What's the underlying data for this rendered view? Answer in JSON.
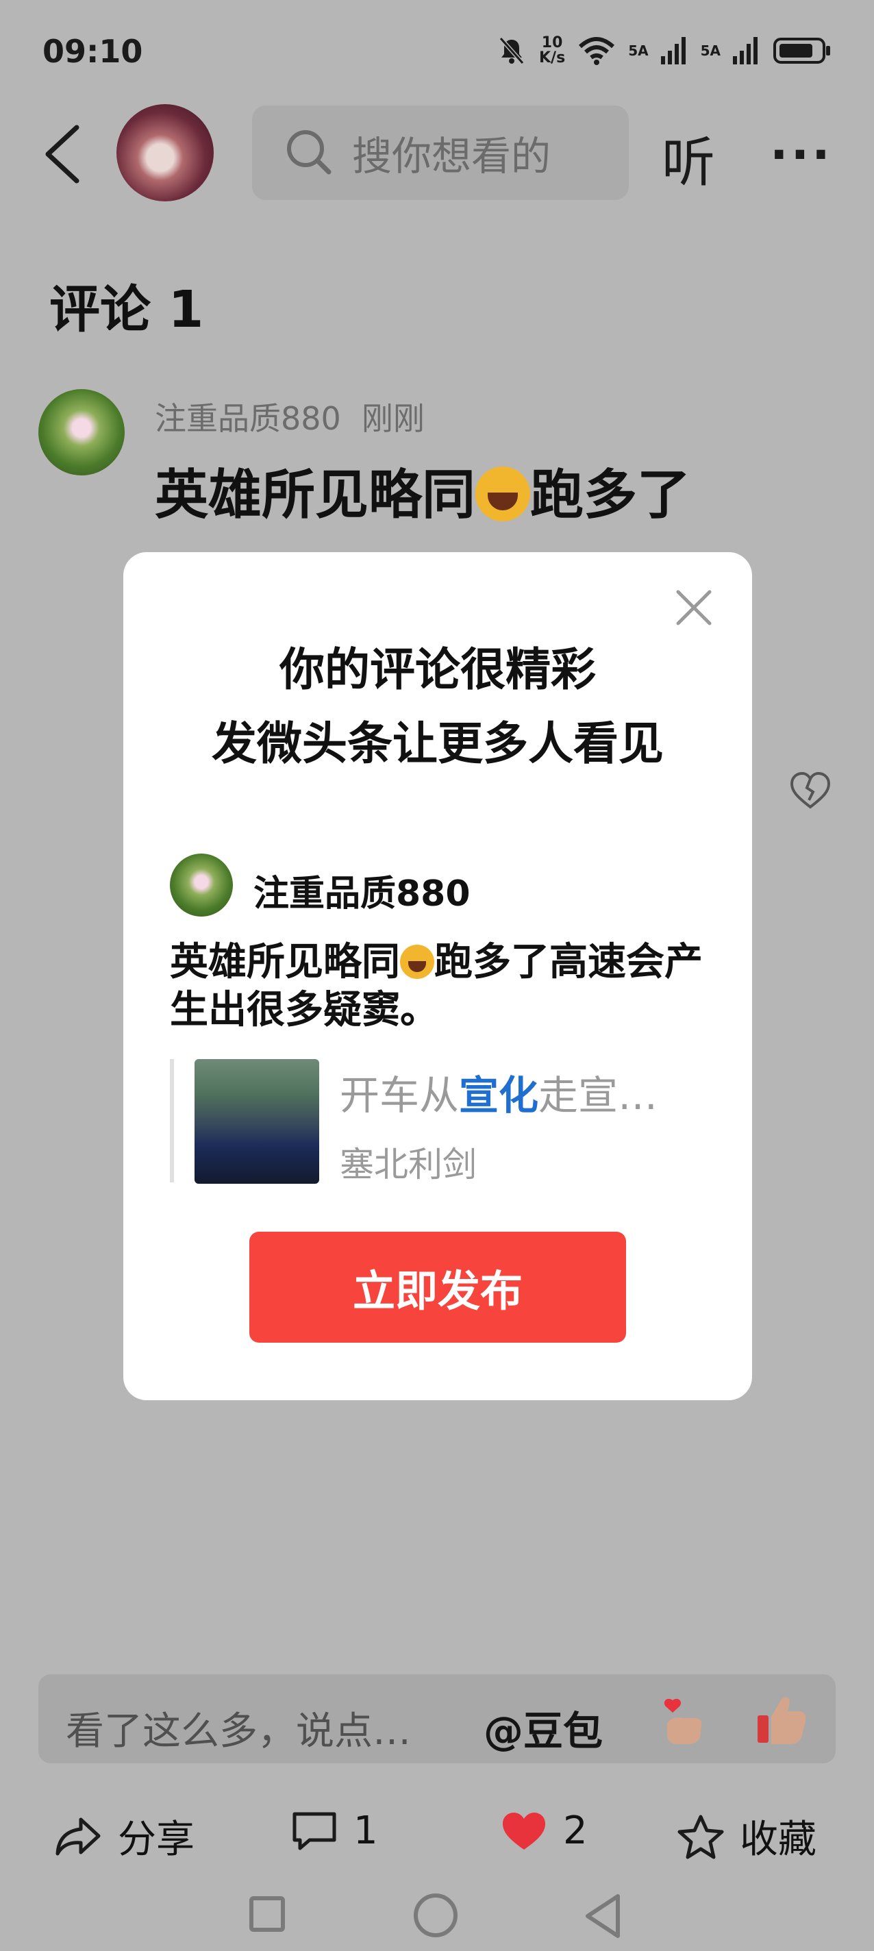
{
  "status_bar": {
    "time": "09:10",
    "net_speed_value": "10",
    "net_speed_unit": "K/s",
    "signal1": "5A",
    "signal2": "5A"
  },
  "header": {
    "search_placeholder": "搜你想看的",
    "listen_label": "听",
    "more_label": "···"
  },
  "comments": {
    "title": "评论 1",
    "items": [
      {
        "author": "注重品质880",
        "time": "刚刚",
        "text_before": "英雄所见略同",
        "text_after": "跑多了"
      }
    ]
  },
  "modal": {
    "title_line1": "你的评论很精彩",
    "title_line2": "发微头条让更多人看见",
    "user_name": "注重品质880",
    "body_before": "英雄所见略同",
    "body_after": "跑多了高速会产生出很多疑窦。",
    "link_title_pre": "开车从",
    "link_title_hl": "宣化",
    "link_title_post": "走宣…",
    "link_author": "塞北利剑",
    "publish_label": "立即发布"
  },
  "input": {
    "placeholder": "看了这么多，说点…",
    "doubao_label": "@豆包"
  },
  "actions": {
    "share_label": "分享",
    "comment_count": "1",
    "like_count": "2",
    "collect_label": "收藏"
  },
  "colors": {
    "publish_bg": "#f7443d",
    "like_heart": "#e8323c",
    "link_highlight": "#1e6fd0"
  }
}
